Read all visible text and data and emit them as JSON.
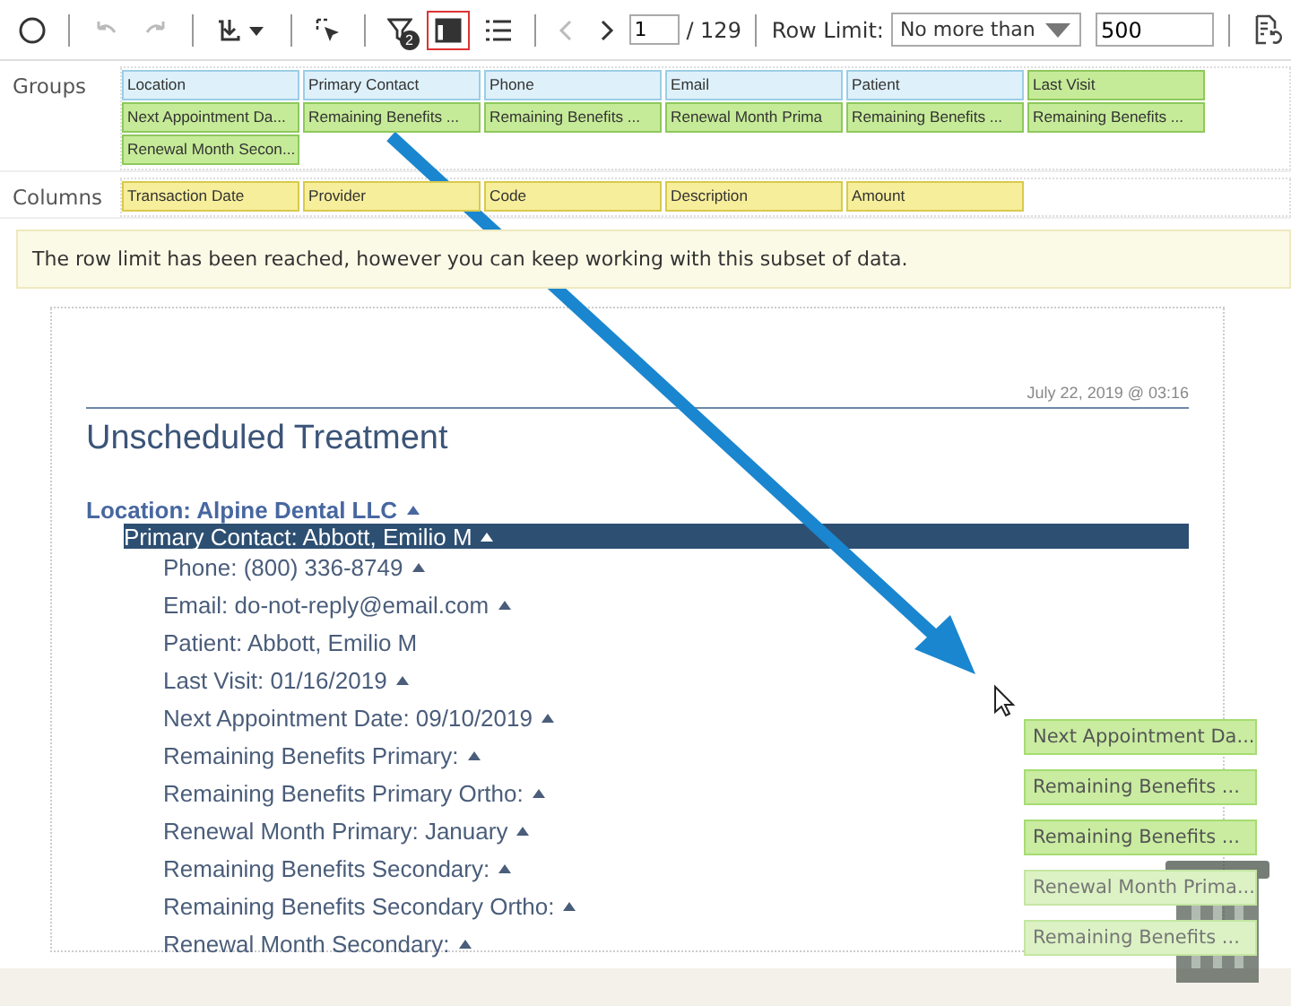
{
  "toolbar": [
    {
      "kind": "circle",
      "disabled": false,
      "selected": false
    },
    {
      "kind": "sep"
    },
    {
      "kind": "undo",
      "disabled": true,
      "selected": false
    },
    {
      "kind": "redo",
      "disabled": true,
      "selected": false
    },
    {
      "kind": "sep"
    },
    {
      "kind": "download",
      "disabled": false,
      "selected": false
    },
    {
      "kind": "sep"
    },
    {
      "kind": "select",
      "disabled": false,
      "selected": false
    },
    {
      "kind": "sep"
    },
    {
      "kind": "filter",
      "badge": "2",
      "disabled": false,
      "selected": false
    },
    {
      "kind": "table",
      "disabled": false,
      "selected": true
    },
    {
      "kind": "list",
      "disabled": false,
      "selected": false
    },
    {
      "kind": "sep"
    },
    {
      "kind": "prev",
      "disabled": true,
      "selected": false
    },
    {
      "kind": "next",
      "disabled": false,
      "selected": false
    }
  ],
  "pager": {
    "page": "1",
    "total": "/ 129"
  },
  "row_limit": {
    "label": "Row Limit:",
    "mode": "No more than",
    "value": "500"
  },
  "groups": {
    "label": "Groups",
    "items": [
      {
        "text": "Location",
        "color": "#def1fb"
      },
      {
        "text": "Primary Contact",
        "color": "#def1fb"
      },
      {
        "text": "Phone",
        "color": "#def1fb"
      },
      {
        "text": "Email",
        "color": "#def1fb"
      },
      {
        "text": "Patient",
        "color": "#def1fb"
      },
      {
        "text": "Last Visit",
        "color": "#c6eb98"
      },
      {
        "text": "Next Appointment Da...",
        "color": "#c6eb98"
      },
      {
        "text": "Remaining Benefits ...",
        "color": "#c6eb98"
      },
      {
        "text": "Remaining Benefits ...",
        "color": "#c6eb98"
      },
      {
        "text": "Renewal Month Prima",
        "color": "#c6eb98"
      },
      {
        "text": "Remaining Benefits ...",
        "color": "#c6eb98"
      },
      {
        "text": "Remaining Benefits ...",
        "color": "#c6eb98"
      },
      {
        "text": "Renewal Month Secon...",
        "color": "#c6eb98"
      }
    ]
  },
  "columns": {
    "label": "Columns",
    "items": [
      "Transaction Date",
      "Provider",
      "Code",
      "Description",
      "Amount"
    ]
  },
  "notice": "The row limit has been reached, however you can keep working with this subset of data.",
  "report": {
    "timestamp": "July 22, 2019 @ 03:16",
    "title": "Unscheduled Treatment",
    "tree": [
      {
        "text": "Location: Alpine Dental LLC",
        "caret": true,
        "selected": false,
        "children": [
          {
            "text": "Primary Contact: Abbott, Emilio M",
            "caret": true,
            "selected": true,
            "children": [
              {
                "text": "Phone: (800) 336-8749",
                "caret": true,
                "selected": false
              },
              {
                "text": "Email: do-not-reply@email.com",
                "caret": true,
                "selected": false
              },
              {
                "text": "Patient: Abbott, Emilio M",
                "caret": false,
                "selected": false
              },
              {
                "text": "Last Visit:  01/16/2019",
                "caret": true,
                "selected": false
              },
              {
                "text": "Next Appointment Date:  09/10/2019",
                "caret": true,
                "selected": false
              },
              {
                "text": "Remaining Benefits Primary:",
                "caret": true,
                "selected": false
              },
              {
                "text": "Remaining Benefits Primary Ortho:",
                "caret": true,
                "selected": false
              },
              {
                "text": "Renewal Month Primary: January",
                "caret": true,
                "selected": false
              },
              {
                "text": "Remaining Benefits Secondary:",
                "caret": true,
                "selected": false
              },
              {
                "text": "Remaining Benefits Secondary Ortho:",
                "caret": true,
                "selected": false
              },
              {
                "text": "Renewal Month Secondary:",
                "caret": true,
                "selected": false
              }
            ]
          }
        ]
      }
    ]
  },
  "dragged": [
    {
      "text": "Next Appointment Da...",
      "faded": false
    },
    {
      "text": "Remaining Benefits ...",
      "faded": false
    },
    {
      "text": "Remaining Benefits ...",
      "faded": false
    },
    {
      "text": "Renewal Month Prima...",
      "faded": true
    },
    {
      "text": "Remaining Benefits ...",
      "faded": true
    }
  ]
}
